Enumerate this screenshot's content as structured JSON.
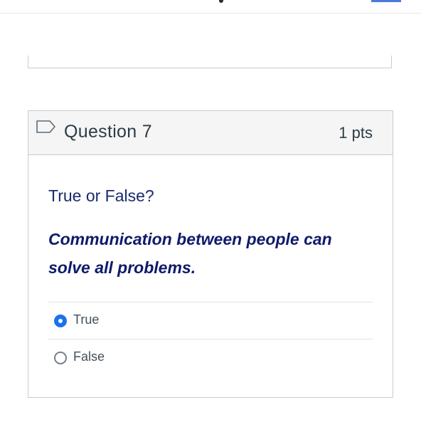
{
  "question": {
    "title": "Question 7",
    "points": "1 pts",
    "prompt": "True or False?",
    "statement": "Communication between people can solve all problems.",
    "answers": [
      {
        "label": "True",
        "selected": true
      },
      {
        "label": "False",
        "selected": false
      }
    ]
  },
  "colors": {
    "accent": "#1a73e8",
    "statement_text": "#0e1a6b",
    "header_bg": "#f5f5f5",
    "border": "#c7cdd1"
  }
}
